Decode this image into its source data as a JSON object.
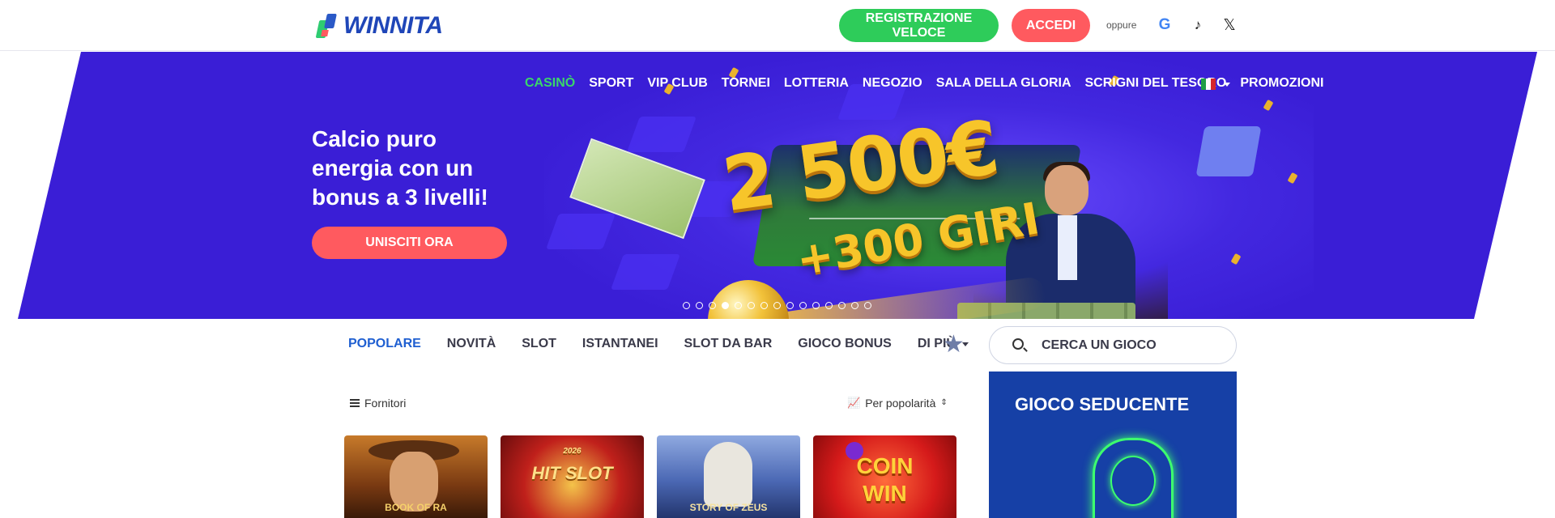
{
  "header": {
    "logo_text": "WINNITA",
    "register_label": "REGISTRAZIONE VELOCE",
    "login_label": "ACCEDI",
    "or_label": "oppure",
    "social": [
      "google-icon",
      "tiktok-icon",
      "x-icon"
    ]
  },
  "nav": {
    "items": [
      "CASINÒ",
      "SPORT",
      "VIP CLUB",
      "TORNEI",
      "LOTTERIA",
      "NEGOZIO",
      "SALA DELLA GLORIA",
      "SCRIGNI DEL TESORO",
      "PROMOZIONI"
    ],
    "active_index": 0,
    "language": "it"
  },
  "hero": {
    "title": "Calcio puro energia con un bonus a 3 livelli!",
    "cta_label": "UNISCITI ORA",
    "bonus_line1": "2 500€",
    "bonus_line2": "+300 GIRI",
    "slide_count": 15,
    "active_slide": 3,
    "colors": {
      "background": "#3a1ed6",
      "cta": "#ff5a5f",
      "active_nav": "#3ad66a"
    }
  },
  "categories": {
    "items": [
      "POPOLARE",
      "NOVITÀ",
      "SLOT",
      "ISTANTANEI",
      "SLOT DA BAR",
      "GIOCO BONUS",
      "DI PIÙ"
    ],
    "active_index": 0
  },
  "search": {
    "placeholder": "CERCA UN GIOCO"
  },
  "filters": {
    "providers_label": "Fornitori",
    "sort_label": "Per popolarità"
  },
  "games": [
    {
      "title": "BOOK OF RA"
    },
    {
      "title": "HIT SLOT",
      "badge": "2026"
    },
    {
      "title": "STORY OF ZEUS"
    },
    {
      "title_line1": "COIN",
      "title_line2": "WIN"
    }
  ],
  "promo": {
    "title": "GIOCO SEDUCENTE"
  }
}
